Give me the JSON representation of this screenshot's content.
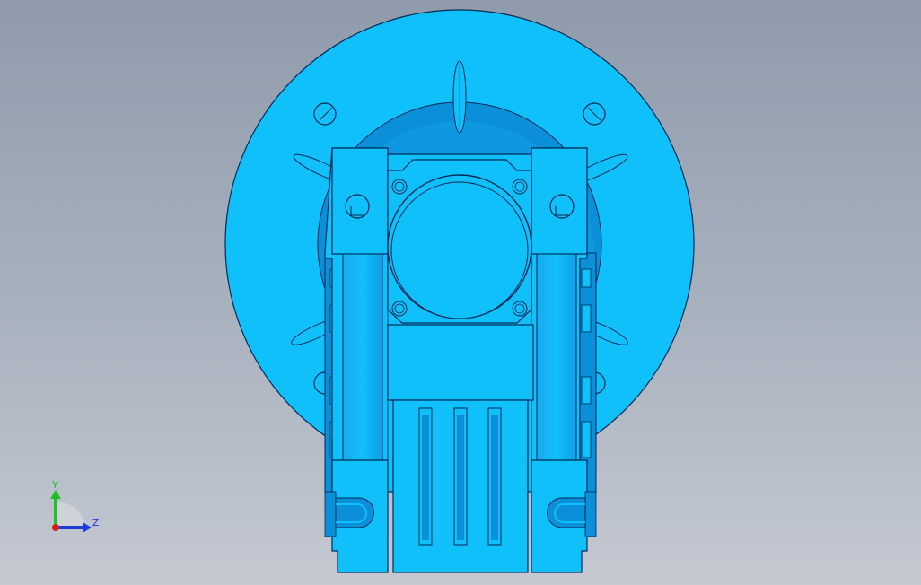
{
  "viewport": {
    "background_top": "#8f9bab",
    "background_bottom": "#c4c9d2"
  },
  "model": {
    "body_color": "#10c0fb",
    "shade_color": "#0a8fd8",
    "edge_color": "#002a55"
  },
  "triad": {
    "y_label": "Y",
    "z_label": "Z",
    "y_color": "#1dc21d",
    "z_color": "#1d3dd8",
    "x_color": "#d81d1d"
  }
}
